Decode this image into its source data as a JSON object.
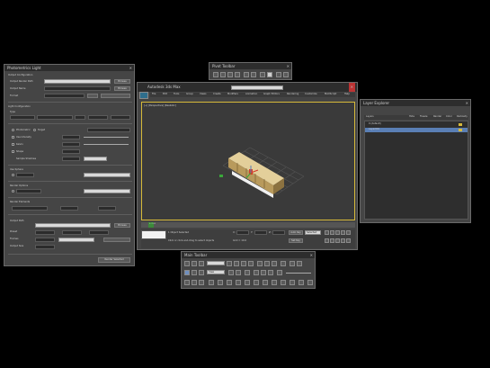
{
  "left_window": {
    "title": "Photometrics Light",
    "rows": {
      "r1": "Output Configuration",
      "r2": "Output Render Path",
      "r3": "Output Name",
      "r4": "Format",
      "r5": "Light Configuration",
      "r6": "Type",
      "r7": "Photometric",
      "r8": "Target",
      "r9": "Use Intensity",
      "r10": "Kelvin",
      "r11": "Shape",
      "r12": "Sample Shadows",
      "r13": "Use Sphere",
      "r14": "Render Options",
      "r15": "Render Elements",
      "r16": "Output Path",
      "r17": "Preset",
      "r18": "Frames",
      "r19": "Output Size"
    },
    "browse_label": "Browse",
    "render_label": "Render Selected"
  },
  "toolbar_top": {
    "title": "Pivot Toolbar"
  },
  "viewport_window": {
    "title": "Autodesk 3ds Max",
    "menu": [
      "File",
      "Edit",
      "Tools",
      "Group",
      "Views",
      "Create",
      "Modifiers",
      "Animation",
      "Graph Editors",
      "Rendering",
      "Customize",
      "MAXScript",
      "Help"
    ],
    "search_placeholder": "Type a keyword or phrase",
    "viewport_label": "[+] [Perspective] [Realistic]",
    "timeline_frame": "0 / 100",
    "status_selection": "1 Object Selected",
    "status_hint": "Click or click-and-drag to select objects",
    "x_label": "X:",
    "y_label": "Y:",
    "z_label": "Z:",
    "grid_label": "Grid = 10.0",
    "autokey_label": "Auto Key",
    "setkey_label": "Set Key",
    "selected_label": "Selected"
  },
  "layer_window": {
    "title": "Layer Explorer",
    "columns": [
      "Layers",
      "Hide",
      "Freeze",
      "Render",
      "Color",
      "Radiosity"
    ],
    "rows": [
      "0 (default)",
      "Layer001"
    ]
  },
  "toolbar_bottom": {
    "title": "Main Toolbar",
    "dropdown_value": "View"
  },
  "colors": {
    "accent_yellow": "#d6b93a",
    "timeline_green": "#3c8a3a",
    "selection_blue": "#5a7fb5"
  }
}
